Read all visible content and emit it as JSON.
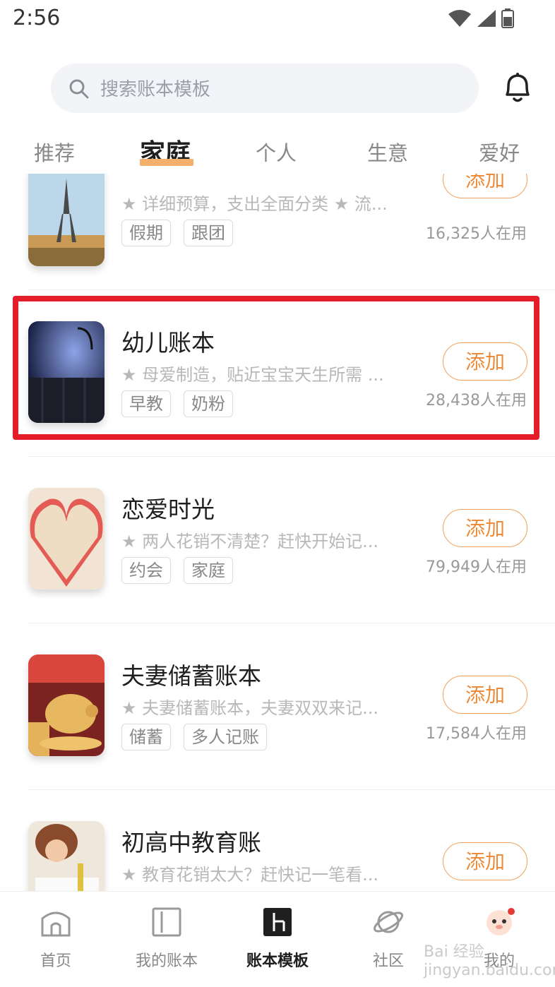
{
  "status_bar": {
    "time": "2:56"
  },
  "search": {
    "placeholder": "搜索账本模板"
  },
  "tabs": [
    {
      "label": "推荐"
    },
    {
      "label": "家庭"
    },
    {
      "label": "个人"
    },
    {
      "label": "生意"
    },
    {
      "label": "爱好"
    }
  ],
  "items": [
    {
      "title": "",
      "desc": "★ 详细预算，支出全面分类 ★ 流...",
      "tags": [
        "假期",
        "跟团"
      ],
      "button": "添加",
      "users": "16,325人在用",
      "icon": "eiffel-tower-thumbnail"
    },
    {
      "title": "幼儿账本",
      "desc": "★ 母爱制造，贴近宝宝天生所需 ...",
      "tags": [
        "早教",
        "奶粉"
      ],
      "button": "添加",
      "users": "28,438人在用",
      "icon": "baby-crib-thumbnail"
    },
    {
      "title": "恋爱时光",
      "desc": "★ 两人花销不清楚？赶快开始记...",
      "tags": [
        "约会",
        "家庭"
      ],
      "button": "添加",
      "users": "79,949人在用",
      "icon": "paper-heart-thumbnail"
    },
    {
      "title": "夫妻储蓄账本",
      "desc": "★ 夫妻储蓄账本，夫妻双双来记...",
      "tags": [
        "储蓄",
        "多人记账"
      ],
      "button": "添加",
      "users": "17,584人在用",
      "icon": "piggy-bank-thumbnail"
    },
    {
      "title": "初高中教育账",
      "desc": "★ 教育花销太大？赶快记一笔看...",
      "tags": [],
      "button": "添加",
      "users": "",
      "icon": "student-studying-thumbnail"
    }
  ],
  "bottom_nav": [
    {
      "label": "首页"
    },
    {
      "label": "我的账本"
    },
    {
      "label": "账本模板"
    },
    {
      "label": "社区"
    },
    {
      "label": "我的"
    }
  ],
  "watermark": "Bai 经验 jingyan.baidu.com",
  "colors": {
    "accent": "#ec8b3a",
    "highlight": "#e51c2a",
    "tab_underline": "#f4b06b"
  }
}
